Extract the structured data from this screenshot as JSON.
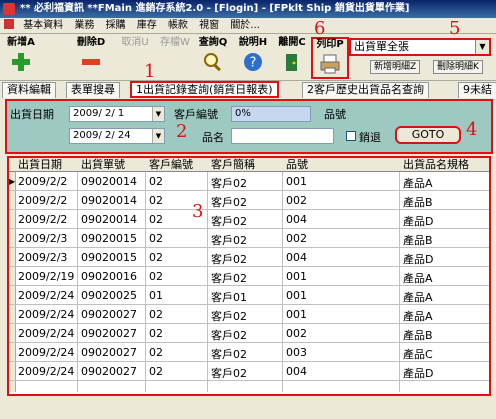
{
  "window": {
    "title": "** 必利福資訊 **FMain  進銷存系統2.0 - [Flogin] - [FPklt Ship  銷貨出貨單作業]"
  },
  "menu": [
    "基本資料",
    "業務",
    "採購",
    "庫存",
    "帳款",
    "視窗",
    "關於..."
  ],
  "toolbar": {
    "add": "新增A",
    "delete": "刪除D",
    "cancel": "取消U",
    "save": "存檔W",
    "query": "查詢Q",
    "help": "說明H",
    "exit": "離開C",
    "print": "列印P",
    "report_select": "出貨單全張",
    "add_detail": "新增明細Z",
    "delete_detail": "刪除明細K"
  },
  "tabs": [
    "資料編輯",
    "表單搜尋",
    "1出貨記錄查詢(銷貨日報表)",
    "2客戶歷史出貨品名查詢",
    "9未結"
  ],
  "filters": {
    "date_label": "出貨日期",
    "date_from": "2009/ 2/ 1",
    "date_to": "2009/ 2/ 24",
    "customer_label": "客戶編號",
    "customer_value": "0%",
    "product_no_label": "品號",
    "product_name_label": "品名",
    "return_label": "銷退",
    "goto_label": "GOTO"
  },
  "grid": {
    "columns": [
      "出貨日期",
      "出貨單號",
      "客戶編號",
      "客戶簡稱",
      "品號",
      "出貨品名規格"
    ],
    "rows": [
      [
        "2009/2/2",
        "09020014",
        "02",
        "客戶02",
        "001",
        "產品A"
      ],
      [
        "2009/2/2",
        "09020014",
        "02",
        "客戶02",
        "002",
        "產品B"
      ],
      [
        "2009/2/2",
        "09020014",
        "02",
        "客戶02",
        "004",
        "產品D"
      ],
      [
        "2009/2/3",
        "09020015",
        "02",
        "客戶02",
        "002",
        "產品B"
      ],
      [
        "2009/2/3",
        "09020015",
        "02",
        "客戶02",
        "004",
        "產品D"
      ],
      [
        "2009/2/19",
        "09020016",
        "02",
        "客戶02",
        "001",
        "產品A"
      ],
      [
        "2009/2/24",
        "09020025",
        "01",
        "客戶01",
        "001",
        "產品A"
      ],
      [
        "2009/2/24",
        "09020027",
        "02",
        "客戶02",
        "001",
        "產品A"
      ],
      [
        "2009/2/24",
        "09020027",
        "02",
        "客戶02",
        "002",
        "產品B"
      ],
      [
        "2009/2/24",
        "09020027",
        "02",
        "客戶02",
        "003",
        "產品C"
      ],
      [
        "2009/2/24",
        "09020027",
        "02",
        "客戶02",
        "004",
        "產品D"
      ]
    ]
  },
  "annotations": [
    "1",
    "2",
    "3",
    "4",
    "5",
    "6"
  ],
  "colors": {
    "highlight": "#dd1111",
    "panel": "#9ec9c0",
    "titlebar": "#0a246a"
  }
}
